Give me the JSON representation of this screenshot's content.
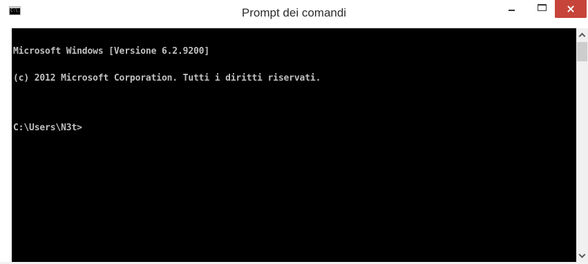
{
  "window": {
    "title": "Prompt dei comandi",
    "icon": "cmd-icon",
    "icon_label": "C:\\.",
    "close_color": "#c7443a"
  },
  "console": {
    "background": "#000000",
    "foreground": "#c0c0c0",
    "lines": [
      "Microsoft Windows [Versione 6.2.9200]",
      "(c) 2012 Microsoft Corporation. Tutti i diritti riservati.",
      "C:\\Users\\N3t>"
    ]
  },
  "controls": {
    "minimize": "minimize-icon",
    "maximize": "maximize-icon",
    "close": "close-icon"
  },
  "scrollbar": {
    "up": "chevron-up-icon",
    "down": "chevron-down-icon"
  }
}
